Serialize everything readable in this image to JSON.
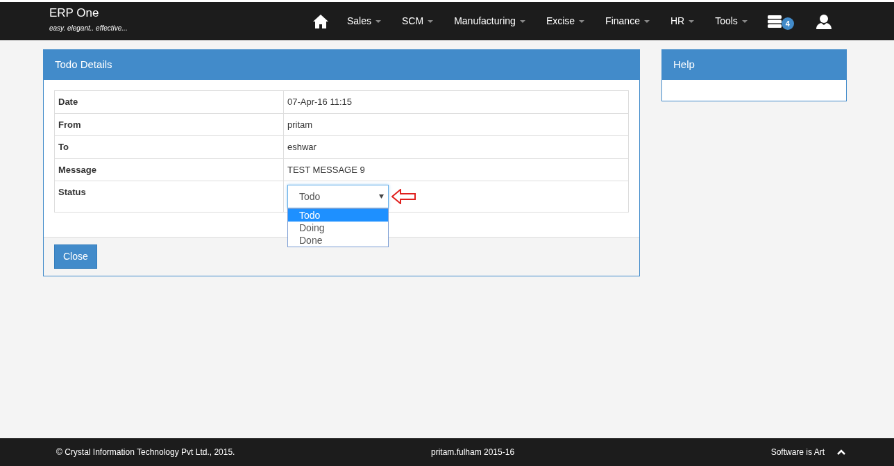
{
  "brand": {
    "title": "ERP One",
    "tagline": "easy. elegant.. effective..."
  },
  "nav": {
    "menus": [
      {
        "label": "Sales"
      },
      {
        "label": "SCM"
      },
      {
        "label": "Manufacturing"
      },
      {
        "label": "Excise"
      },
      {
        "label": "Finance"
      },
      {
        "label": "HR"
      },
      {
        "label": "Tools"
      }
    ],
    "notification_count": "4"
  },
  "todo_panel": {
    "title": "Todo Details",
    "fields": [
      {
        "label": "Date",
        "value": "07-Apr-16 11:15"
      },
      {
        "label": "From",
        "value": "pritam"
      },
      {
        "label": "To",
        "value": "eshwar"
      },
      {
        "label": "Message",
        "value": "TEST MESSAGE 9"
      }
    ],
    "status": {
      "label": "Status",
      "value": "Todo",
      "expanded": true,
      "options": [
        {
          "label": "Todo",
          "selected": true
        },
        {
          "label": "Doing",
          "selected": false
        },
        {
          "label": "Done",
          "selected": false
        }
      ]
    },
    "close_button": "Close"
  },
  "help_panel": {
    "title": "Help"
  },
  "footer": {
    "copyright": "© Crystal Information Technology Pvt Ltd., 2015.",
    "user": "pritam.fulham 2015-16",
    "slogan": "Software is Art"
  }
}
